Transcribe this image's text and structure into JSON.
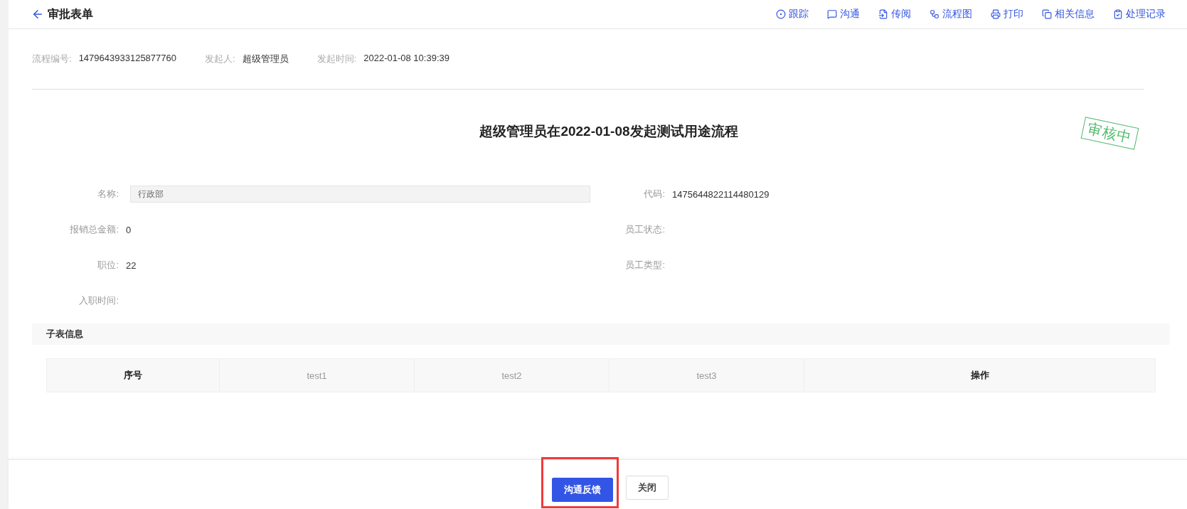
{
  "header": {
    "title": "审批表单",
    "actions": [
      {
        "kind": "track",
        "label": "跟踪"
      },
      {
        "kind": "chat",
        "label": "沟通"
      },
      {
        "kind": "forward",
        "label": "传阅"
      },
      {
        "kind": "flow",
        "label": "流程图"
      },
      {
        "kind": "print",
        "label": "打印"
      },
      {
        "kind": "related",
        "label": "相关信息"
      },
      {
        "kind": "log",
        "label": "处理记录"
      }
    ]
  },
  "meta": [
    {
      "label": "流程编号:",
      "value": "1479643933125877760"
    },
    {
      "label": "发起人:",
      "value": "超级管理员"
    },
    {
      "label": "发起时间:",
      "value": "2022-01-08 10:39:39"
    }
  ],
  "document": {
    "title": "超级管理员在2022-01-08发起测试用途流程",
    "stamp": "审核中"
  },
  "form": {
    "rows": [
      {
        "left": {
          "label": "名称:",
          "kind": "input",
          "value": "行政部"
        },
        "right": {
          "label": "代码:",
          "value": "1475644822114480129"
        }
      },
      {
        "left": {
          "label": "报销总金额:",
          "value": "0"
        },
        "right": {
          "label": "员工状态:"
        }
      },
      {
        "left": {
          "label": "职位:",
          "value": "22"
        },
        "right": {
          "label": "员工类型:"
        }
      },
      {
        "left": {
          "label": "入职时间:"
        }
      }
    ]
  },
  "subtable": {
    "title": "子表信息",
    "columns": [
      {
        "label": "序号",
        "bold": true
      },
      {
        "label": "test1",
        "bold": false
      },
      {
        "label": "test2",
        "bold": false
      },
      {
        "label": "test3",
        "bold": false
      },
      {
        "label": "操作",
        "bold": true
      }
    ]
  },
  "footer": {
    "buttons": [
      {
        "label": "沟通反馈",
        "primary": true,
        "highlighted": true
      },
      {
        "label": "关闭",
        "primary": false,
        "highlighted": false
      }
    ]
  }
}
